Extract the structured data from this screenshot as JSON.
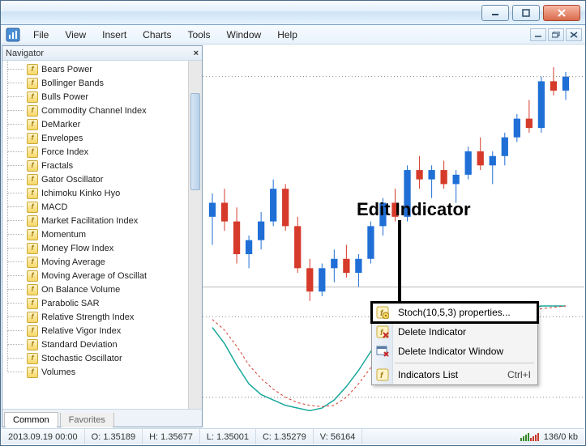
{
  "window_controls": {
    "minimize": "–",
    "maximize": "□",
    "close": "×"
  },
  "mdi_controls": {
    "minimize": "–",
    "restore": "❐",
    "close": "×"
  },
  "menu": [
    "File",
    "View",
    "Insert",
    "Charts",
    "Tools",
    "Window",
    "Help"
  ],
  "navigator": {
    "title": "Navigator",
    "items": [
      "Bears Power",
      "Bollinger Bands",
      "Bulls Power",
      "Commodity Channel Index",
      "DeMarker",
      "Envelopes",
      "Force Index",
      "Fractals",
      "Gator Oscillator",
      "Ichimoku Kinko Hyo",
      "MACD",
      "Market Facilitation Index",
      "Momentum",
      "Money Flow Index",
      "Moving Average",
      "Moving Average of Oscillat",
      "On Balance Volume",
      "Parabolic SAR",
      "Relative Strength Index",
      "Relative Vigor Index",
      "Standard Deviation",
      "Stochastic Oscillator",
      "Volumes"
    ],
    "tabs": {
      "active": "Common",
      "inactive": "Favorites"
    }
  },
  "context_menu": {
    "items": [
      {
        "label": "Stoch(10,5,3) properties...",
        "highlight": true,
        "icon": "indicator-props"
      },
      {
        "label": "Delete Indicator",
        "icon": "indicator-delete"
      },
      {
        "label": "Delete Indicator Window",
        "icon": "window-delete"
      },
      {
        "sep": true
      },
      {
        "label": "Indicators List",
        "shortcut": "Ctrl+I",
        "icon": "indicators-list"
      }
    ]
  },
  "annotation": {
    "label": "Edit Indicator"
  },
  "status": {
    "datetime": "2013.09.19 00:00",
    "o_label": "O:",
    "o": "1.35189",
    "h_label": "H:",
    "h": "1.35677",
    "l_label": "L:",
    "l": "1.35001",
    "c_label": "C:",
    "c": "1.35279",
    "v_label": "V:",
    "v": "56164",
    "conn": "136/0 kb"
  },
  "chart_data": {
    "type": "candlestick+indicator",
    "note": "values estimated from pixels; no axis labels visible",
    "price_range_est": [
      1.348,
      1.358
    ],
    "candles": [
      {
        "o": 1.3508,
        "h": 1.3518,
        "l": 1.3496,
        "c": 1.3514,
        "dir": "up"
      },
      {
        "o": 1.3514,
        "h": 1.352,
        "l": 1.3502,
        "c": 1.3506,
        "dir": "down"
      },
      {
        "o": 1.3506,
        "h": 1.3512,
        "l": 1.3488,
        "c": 1.3492,
        "dir": "down"
      },
      {
        "o": 1.3492,
        "h": 1.35,
        "l": 1.3486,
        "c": 1.3498,
        "dir": "up"
      },
      {
        "o": 1.3498,
        "h": 1.351,
        "l": 1.3494,
        "c": 1.3506,
        "dir": "up"
      },
      {
        "o": 1.3506,
        "h": 1.3524,
        "l": 1.3504,
        "c": 1.352,
        "dir": "up"
      },
      {
        "o": 1.352,
        "h": 1.3522,
        "l": 1.3502,
        "c": 1.3504,
        "dir": "down"
      },
      {
        "o": 1.3504,
        "h": 1.3508,
        "l": 1.3484,
        "c": 1.3486,
        "dir": "down"
      },
      {
        "o": 1.3486,
        "h": 1.349,
        "l": 1.3472,
        "c": 1.3476,
        "dir": "down"
      },
      {
        "o": 1.3476,
        "h": 1.3488,
        "l": 1.3474,
        "c": 1.3486,
        "dir": "up"
      },
      {
        "o": 1.3486,
        "h": 1.3494,
        "l": 1.348,
        "c": 1.349,
        "dir": "up"
      },
      {
        "o": 1.349,
        "h": 1.3496,
        "l": 1.3482,
        "c": 1.3484,
        "dir": "down"
      },
      {
        "o": 1.3484,
        "h": 1.3492,
        "l": 1.3478,
        "c": 1.349,
        "dir": "up"
      },
      {
        "o": 1.349,
        "h": 1.3506,
        "l": 1.3488,
        "c": 1.3504,
        "dir": "up"
      },
      {
        "o": 1.3504,
        "h": 1.3516,
        "l": 1.35,
        "c": 1.3514,
        "dir": "up"
      },
      {
        "o": 1.3514,
        "h": 1.352,
        "l": 1.3506,
        "c": 1.3508,
        "dir": "down"
      },
      {
        "o": 1.3508,
        "h": 1.353,
        "l": 1.3506,
        "c": 1.3528,
        "dir": "up"
      },
      {
        "o": 1.3528,
        "h": 1.3534,
        "l": 1.352,
        "c": 1.3524,
        "dir": "down"
      },
      {
        "o": 1.3524,
        "h": 1.353,
        "l": 1.3516,
        "c": 1.3528,
        "dir": "up"
      },
      {
        "o": 1.3528,
        "h": 1.3532,
        "l": 1.352,
        "c": 1.3522,
        "dir": "down"
      },
      {
        "o": 1.3522,
        "h": 1.3528,
        "l": 1.3514,
        "c": 1.3526,
        "dir": "up"
      },
      {
        "o": 1.3526,
        "h": 1.3538,
        "l": 1.3524,
        "c": 1.3536,
        "dir": "up"
      },
      {
        "o": 1.3536,
        "h": 1.3542,
        "l": 1.3528,
        "c": 1.353,
        "dir": "down"
      },
      {
        "o": 1.353,
        "h": 1.3536,
        "l": 1.3522,
        "c": 1.3534,
        "dir": "up"
      },
      {
        "o": 1.3534,
        "h": 1.3544,
        "l": 1.353,
        "c": 1.3542,
        "dir": "up"
      },
      {
        "o": 1.3542,
        "h": 1.3552,
        "l": 1.354,
        "c": 1.355,
        "dir": "up"
      },
      {
        "o": 1.355,
        "h": 1.3558,
        "l": 1.3544,
        "c": 1.3546,
        "dir": "down"
      },
      {
        "o": 1.3546,
        "h": 1.3568,
        "l": 1.3544,
        "c": 1.3566,
        "dir": "up"
      },
      {
        "o": 1.3566,
        "h": 1.3572,
        "l": 1.356,
        "c": 1.3562,
        "dir": "down"
      },
      {
        "o": 1.3562,
        "h": 1.357,
        "l": 1.3558,
        "c": 1.3568,
        "dir": "up"
      }
    ],
    "stochastic": {
      "params": "10,5,3",
      "range": [
        0,
        100
      ],
      "main": [
        72,
        60,
        44,
        30,
        22,
        18,
        14,
        12,
        10,
        12,
        18,
        28,
        40,
        54,
        66,
        76,
        84,
        88,
        90,
        88,
        84,
        80,
        78,
        80,
        82,
        84,
        86,
        88,
        88,
        88
      ],
      "signal": [
        78,
        70,
        58,
        44,
        34,
        26,
        20,
        16,
        14,
        13,
        14,
        20,
        30,
        42,
        54,
        66,
        76,
        82,
        86,
        88,
        87,
        84,
        81,
        80,
        80,
        82,
        84,
        86,
        87,
        88
      ]
    }
  }
}
